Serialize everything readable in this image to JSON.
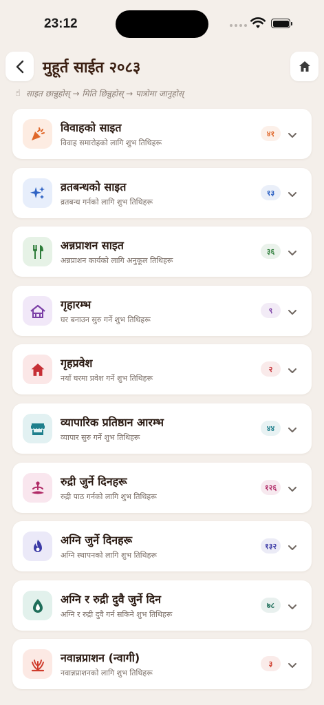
{
  "status": {
    "time": "23:12"
  },
  "header": {
    "title": "मुहूर्त साईत २०८३"
  },
  "hint": {
    "finger": "☝",
    "text": "साइत छान्नुहोस् → मिति छिन्नुहोस् → पात्रोमा जानुहोस्"
  },
  "categories": [
    {
      "title": "विवाहको साइत",
      "subtitle": "विवाह समारोहको लागि शुभ तिथिहरू",
      "count": "४१",
      "icon": "party-popper-icon",
      "accent": "#e0672a",
      "tint": "#fdece2"
    },
    {
      "title": "व्रतबन्धको साइत",
      "subtitle": "व्रतबन्ध गर्नको लागि शुभ तिथिहरू",
      "count": "१३",
      "icon": "sparkles-icon",
      "accent": "#2f63c4",
      "tint": "#e7eefb"
    },
    {
      "title": "अन्नप्राशन साइत",
      "subtitle": "अन्नप्राशन कार्यको लागि अनुकूल तिथिहरू",
      "count": "३६",
      "icon": "fork-knife-icon",
      "accent": "#2e7d3a",
      "tint": "#e6f2e6"
    },
    {
      "title": "गृहारम्भ",
      "subtitle": "घर बनाउन सुरु गर्ने शुभ तिथिहरू",
      "count": "९",
      "icon": "house-frame-icon",
      "accent": "#7b3fa6",
      "tint": "#f1e8f8"
    },
    {
      "title": "गृहप्रवेश",
      "subtitle": "नयाँ घरमा प्रवेश गर्ने शुभ तिथिहरू",
      "count": "२",
      "icon": "home-icon",
      "accent": "#c62f35",
      "tint": "#fbe7e7"
    },
    {
      "title": "व्यापारिक प्रतिष्ठान आरम्भ",
      "subtitle": "व्यापार सुरु गर्ने शुभ तिथिहरू",
      "count": "४४",
      "icon": "storefront-icon",
      "accent": "#1e7f8c",
      "tint": "#e2f1f2"
    },
    {
      "title": "रुद्री जुर्ने दिनहरू",
      "subtitle": "रुद्री पाठ गर्नको लागि शुभ तिथिहरू",
      "count": "१२६",
      "icon": "meditation-icon",
      "accent": "#b02a66",
      "tint": "#f9e6ee"
    },
    {
      "title": "अग्नि जुर्ने दिनहरू",
      "subtitle": "अग्नि स्थापनको लागि शुभ तिथिहरू",
      "count": "१३२",
      "icon": "flame-icon",
      "accent": "#3b3aa6",
      "tint": "#ebe9f8"
    },
    {
      "title": "अग्नि र रुद्री दुवै जुर्ने दिन",
      "subtitle": "अग्नि र रुद्री दुवै गर्न सकिने शुभ तिथिहरू",
      "count": "७८",
      "icon": "fire-drop-icon",
      "accent": "#1f6e5a",
      "tint": "#e2f1ec"
    },
    {
      "title": "नवान्नप्राशन (न्वागी)",
      "subtitle": "नवान्नप्राशनको लागि शुभ तिथिहरू",
      "count": "३",
      "icon": "harvest-icon",
      "accent": "#cf3b2b",
      "tint": "#fce9e4"
    }
  ]
}
